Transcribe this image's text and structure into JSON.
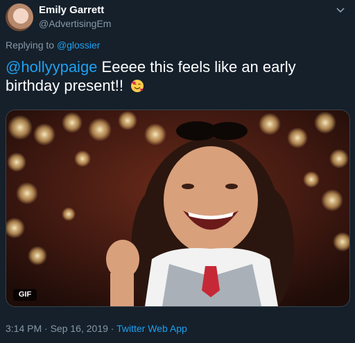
{
  "author": {
    "name": "Emily Garrett",
    "handle": "@AdvertisingEm"
  },
  "reply": {
    "prefix": "Replying to",
    "target": "@glossier"
  },
  "tweet": {
    "mention": "@hollyypaige",
    "text": " Eeeee this feels like an early birthday present!!",
    "emoji_icon": "smiling-face-with-hearts-icon"
  },
  "media": {
    "badge": "GIF"
  },
  "footer": {
    "time": "3:14 PM",
    "date": "Sep 16, 2019",
    "separator": "·",
    "source": "Twitter Web App"
  },
  "colors": {
    "background": "#15202b",
    "accent": "#1da1f2",
    "secondary_text": "#8899a6"
  }
}
